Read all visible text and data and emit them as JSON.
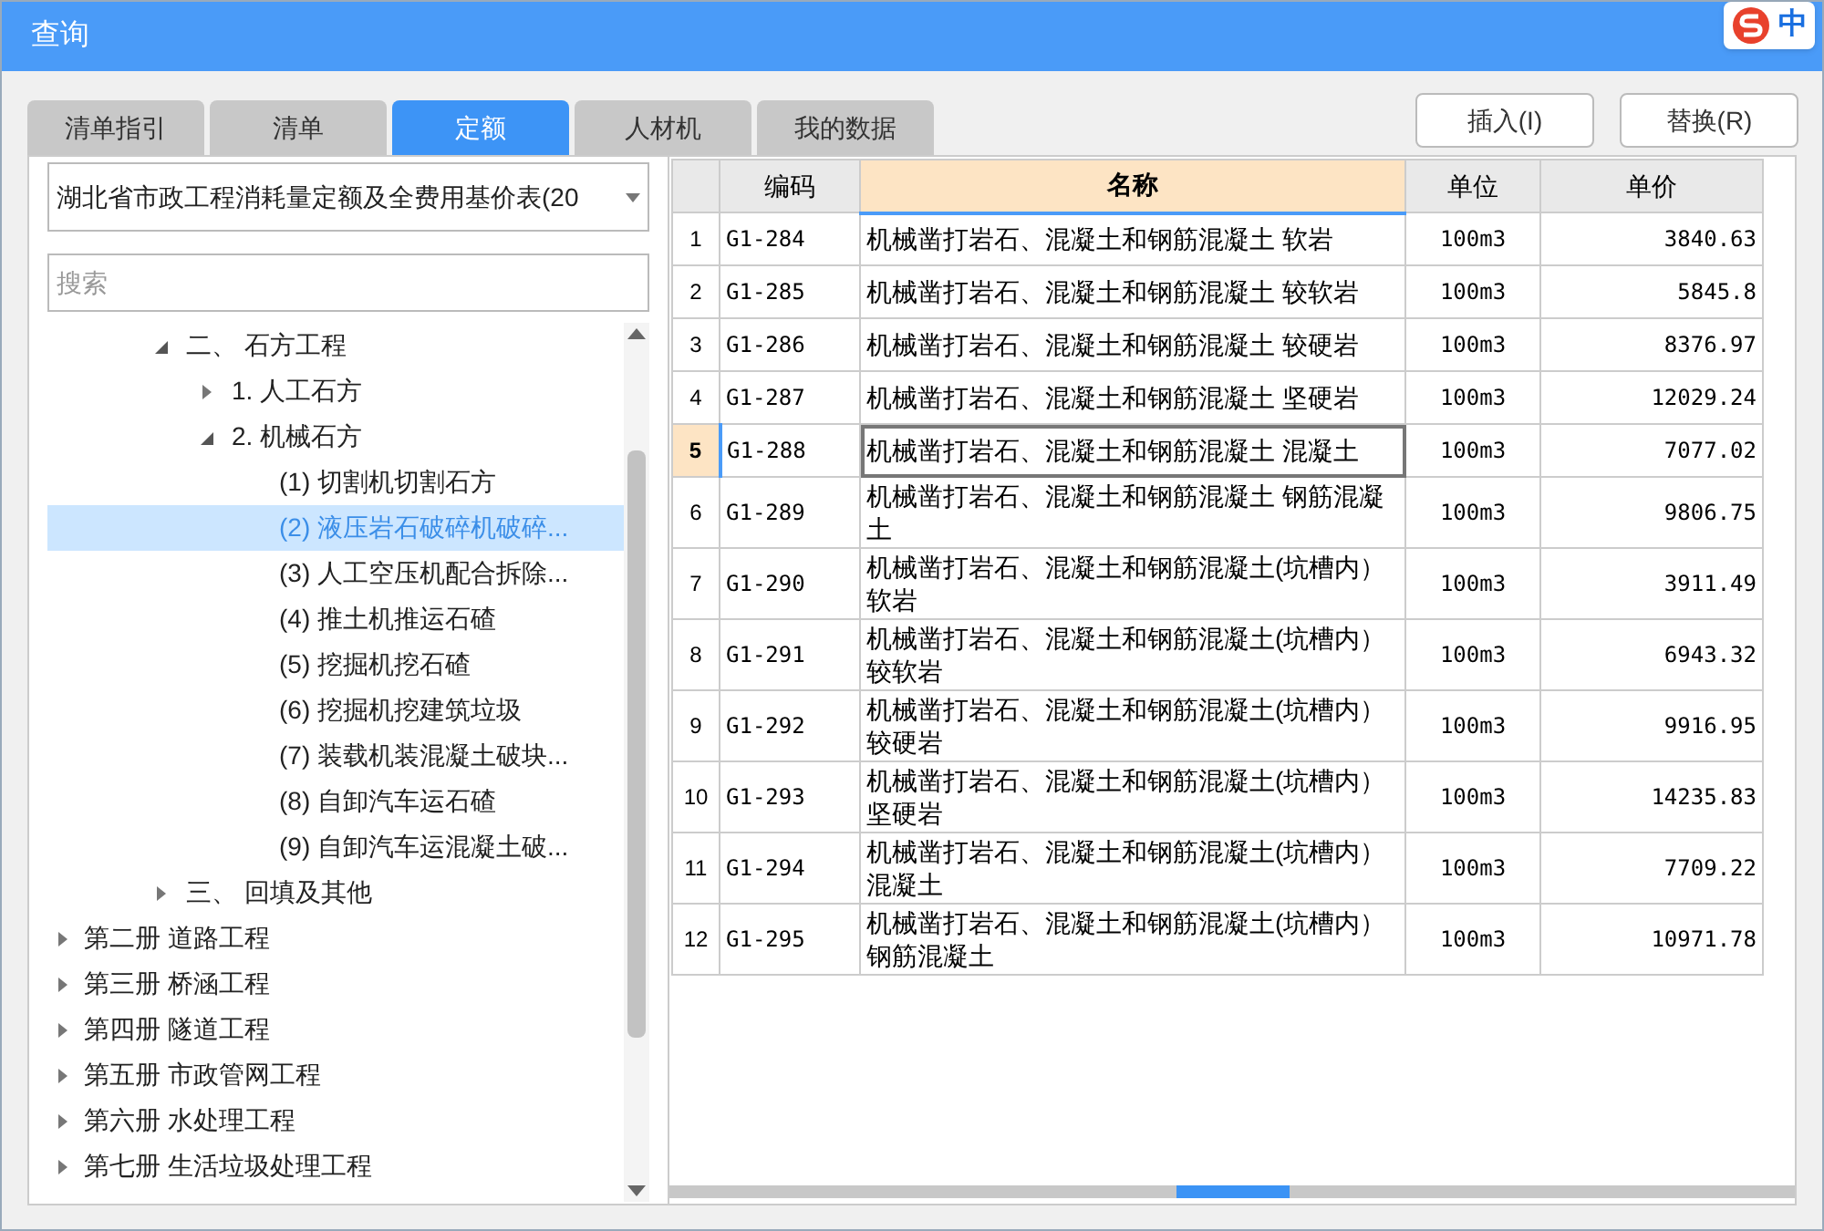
{
  "window": {
    "title": "查询"
  },
  "ime_badge": {
    "label": "中"
  },
  "tabs": [
    {
      "label": "清单指引",
      "selected": false
    },
    {
      "label": "清单",
      "selected": false
    },
    {
      "label": "定额",
      "selected": true
    },
    {
      "label": "人材机",
      "selected": false
    },
    {
      "label": "我的数据",
      "selected": false
    }
  ],
  "buttons": [
    "插入(I)",
    "替换(R)"
  ],
  "library_select": {
    "value": "湖北省市政工程消耗量定额及全费用基价表(20"
  },
  "search": {
    "placeholder": "搜索"
  },
  "tree": {
    "partial_branch": [
      {
        "label": "二、 石方工程",
        "expanded": true,
        "selected": false,
        "children": [
          {
            "label": "1. 人工石方",
            "expanded": false,
            "selected": false
          },
          {
            "label": "2. 机械石方",
            "expanded": true,
            "selected": false,
            "children": [
              {
                "label": "(1) 切割机切割石方",
                "selected": false
              },
              {
                "label": "(2) 液压岩石破碎机破碎...",
                "selected": true
              },
              {
                "label": "(3) 人工空压机配合拆除...",
                "selected": false
              },
              {
                "label": "(4) 推土机推运石碴",
                "selected": false
              },
              {
                "label": "(5) 挖掘机挖石碴",
                "selected": false
              },
              {
                "label": "(6) 挖掘机挖建筑垃圾",
                "selected": false
              },
              {
                "label": "(7) 装载机装混凝土破块...",
                "selected": false
              },
              {
                "label": "(8) 自卸汽车运石碴",
                "selected": false
              },
              {
                "label": "(9) 自卸汽车运混凝土破...",
                "selected": false
              }
            ]
          }
        ]
      },
      {
        "label": "三、 回填及其他",
        "expanded": false,
        "selected": false
      }
    ],
    "items": [
      {
        "label": "第二册 道路工程",
        "expanded": false,
        "selected": false
      },
      {
        "label": "第三册 桥涵工程",
        "expanded": false,
        "selected": false
      },
      {
        "label": "第四册 隧道工程",
        "expanded": false,
        "selected": false
      },
      {
        "label": "第五册 市政管网工程",
        "expanded": false,
        "selected": false
      },
      {
        "label": "第六册 水处理工程",
        "expanded": false,
        "selected": false
      },
      {
        "label": "第七册 生活垃圾处理工程",
        "expanded": false,
        "selected": false
      }
    ]
  },
  "table": {
    "columns": [
      {
        "label": "编码",
        "selected": false
      },
      {
        "label": "名称",
        "selected": true
      },
      {
        "label": "单位",
        "selected": false
      },
      {
        "label": "单价",
        "selected": false
      }
    ],
    "rows": [
      {
        "index": "1",
        "code": "G1-284",
        "name": "机械凿打岩石、混凝土和钢筋混凝土 软岩",
        "unit": "100m3",
        "price": "3840.63",
        "selected": false
      },
      {
        "index": "2",
        "code": "G1-285",
        "name": "机械凿打岩石、混凝土和钢筋混凝土 较软岩",
        "unit": "100m3",
        "price": "5845.8",
        "selected": false
      },
      {
        "index": "3",
        "code": "G1-286",
        "name": "机械凿打岩石、混凝土和钢筋混凝土 较硬岩",
        "unit": "100m3",
        "price": "8376.97",
        "selected": false
      },
      {
        "index": "4",
        "code": "G1-287",
        "name": "机械凿打岩石、混凝土和钢筋混凝土 坚硬岩",
        "unit": "100m3",
        "price": "12029.24",
        "selected": false
      },
      {
        "index": "5",
        "code": "G1-288",
        "name": "机械凿打岩石、混凝土和钢筋混凝土 混凝土",
        "unit": "100m3",
        "price": "7077.02",
        "selected": true
      },
      {
        "index": "6",
        "code": "G1-289",
        "name": "机械凿打岩石、混凝土和钢筋混凝土 钢筋混凝土",
        "unit": "100m3",
        "price": "9806.75",
        "selected": false
      },
      {
        "index": "7",
        "code": "G1-290",
        "name": "机械凿打岩石、混凝土和钢筋混凝土(坑槽内）软岩",
        "unit": "100m3",
        "price": "3911.49",
        "selected": false
      },
      {
        "index": "8",
        "code": "G1-291",
        "name": "机械凿打岩石、混凝土和钢筋混凝土(坑槽内）较软岩",
        "unit": "100m3",
        "price": "6943.32",
        "selected": false
      },
      {
        "index": "9",
        "code": "G1-292",
        "name": "机械凿打岩石、混凝土和钢筋混凝土(坑槽内）较硬岩",
        "unit": "100m3",
        "price": "9916.95",
        "selected": false
      },
      {
        "index": "10",
        "code": "G1-293",
        "name": "机械凿打岩石、混凝土和钢筋混凝土(坑槽内）坚硬岩",
        "unit": "100m3",
        "price": "14235.83",
        "selected": false
      },
      {
        "index": "11",
        "code": "G1-294",
        "name": "机械凿打岩石、混凝土和钢筋混凝土(坑槽内）混凝土",
        "unit": "100m3",
        "price": "7709.22",
        "selected": false
      },
      {
        "index": "12",
        "code": "G1-295",
        "name": "机械凿打岩石、混凝土和钢筋混凝土(坑槽内）钢筋混凝土",
        "unit": "100m3",
        "price": "10971.78",
        "selected": false
      }
    ]
  }
}
